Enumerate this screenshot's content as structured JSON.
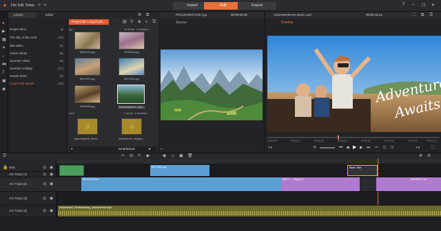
{
  "menu": {
    "file": "File",
    "edit": "Edit",
    "setup": "Setup"
  },
  "modes": {
    "import": "Import",
    "edit": "Edit",
    "export": "Export"
  },
  "library": {
    "tab_library": "Library",
    "tab_editor": "Editor",
    "bins": [
      {
        "label": "Project Bins",
        "count": ""
      },
      {
        "label": "The Sky is the Limit",
        "count": "(15)"
      },
      {
        "label": "360 video",
        "count": "(5)"
      },
      {
        "label": "Action Shots",
        "count": "(6)"
      },
      {
        "label": "Summer Hikes",
        "count": "(9)"
      },
      {
        "label": "Summer Holiday",
        "count": "(37)"
      },
      {
        "label": "Hawaii 2018",
        "count": "(6)"
      },
      {
        "label": "Long Point Beach",
        "count": "(23)"
      }
    ],
    "browser_tab": "Project Bin Long Point...",
    "jpg_group": "jpg",
    "jpg_status": "12 items, 1 selected",
    "items": [
      {
        "label": "IMG6142.jpg"
      },
      {
        "label": "IMG6164.jpg"
      },
      {
        "label": "IMG7022.jpg"
      },
      {
        "label": "IMG7062.jpg"
      },
      {
        "label": "IMG6838.jpg"
      },
      {
        "label": "P52132460472...jpg"
      }
    ],
    "mp3_group": "mp3",
    "mp3_status": "2 items, 0 selected",
    "audio_items": [
      {
        "label": "jaymeisgreat_Reba..."
      },
      {
        "label": "mikaelanoel_awayso..."
      }
    ],
    "smartmovie": "SmartMovie"
  },
  "source": {
    "filename": "P52132460472347.jpg",
    "timecode": "00:00:03.00",
    "label": "Source"
  },
  "preview": {
    "filename": "AdventureMovie.Movie.axp*",
    "timecode": "00:00:46.14",
    "label": "Timeline",
    "overlay_line1": "Adventure",
    "overlay_line2": "Awaits",
    "fit": "Fit",
    "zoom": "Fit",
    "scrub_times": [
      "00:00:00",
      "00:00:10",
      "00:00:20",
      "00:00:30",
      "00:00:40",
      "00:00:50",
      "00:01:00",
      "00:01:10"
    ]
  },
  "timeline": {
    "tracks": [
      {
        "label": "Solo"
      },
      {
        "label": "A/V Track (1)"
      },
      {
        "label": "A/V Track (2)"
      },
      {
        "label": "A/V Track (3)"
      },
      {
        "label": "A/V Track (4)"
      }
    ],
    "clips": {
      "track1a": "IMG1984.jpg",
      "track1b": "Black Title",
      "track2a": "IMG7009.mov",
      "track2b": "IMG7... - Segue A",
      "track2c": "IMG6997.mov",
      "track4": "mikaelanoel_Endlessaway_instrumental.mp3"
    }
  },
  "colors": {
    "accent": "#e8703a",
    "clip_blue": "#5a9fd4",
    "clip_purple": "#b07ad0",
    "clip_green": "#4aa05a",
    "audio": "#6b6a2a"
  }
}
